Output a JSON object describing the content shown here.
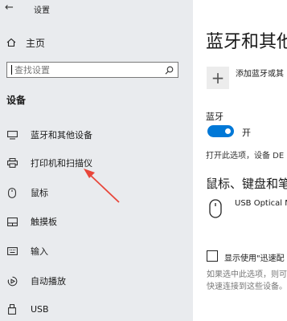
{
  "sidebar": {
    "app_title": "设置",
    "home_label": "主页",
    "search_placeholder": "查找设置",
    "section_label": "设备",
    "items": [
      {
        "label": "蓝牙和其他设备",
        "icon": "bluetooth-devices-icon"
      },
      {
        "label": "打印机和扫描仪",
        "icon": "printer-icon"
      },
      {
        "label": "鼠标",
        "icon": "mouse-icon"
      },
      {
        "label": "触摸板",
        "icon": "touchpad-icon"
      },
      {
        "label": "输入",
        "icon": "keyboard-icon"
      },
      {
        "label": "自动播放",
        "icon": "autoplay-icon"
      },
      {
        "label": "USB",
        "icon": "usb-icon"
      }
    ]
  },
  "main": {
    "title": "蓝牙和其他",
    "add_device_label": "添加蓝牙或其",
    "bluetooth_label": "蓝牙",
    "toggle_state": "开",
    "toggle_on": true,
    "discoverable_text": "打开此选项，设备 DE",
    "subsection_title": "鼠标、键盘和笔",
    "device_name": "USB Optical M",
    "checkbox_label": "显示使用\"迅速配",
    "checkbox_note_line1": "如果选中此选项，则可",
    "checkbox_note_line2": "快速连接到这些设备。"
  },
  "colors": {
    "sidebar_bg": "#e9ebee",
    "accent": "#0078d7",
    "annotation_arrow": "#e8463a"
  }
}
